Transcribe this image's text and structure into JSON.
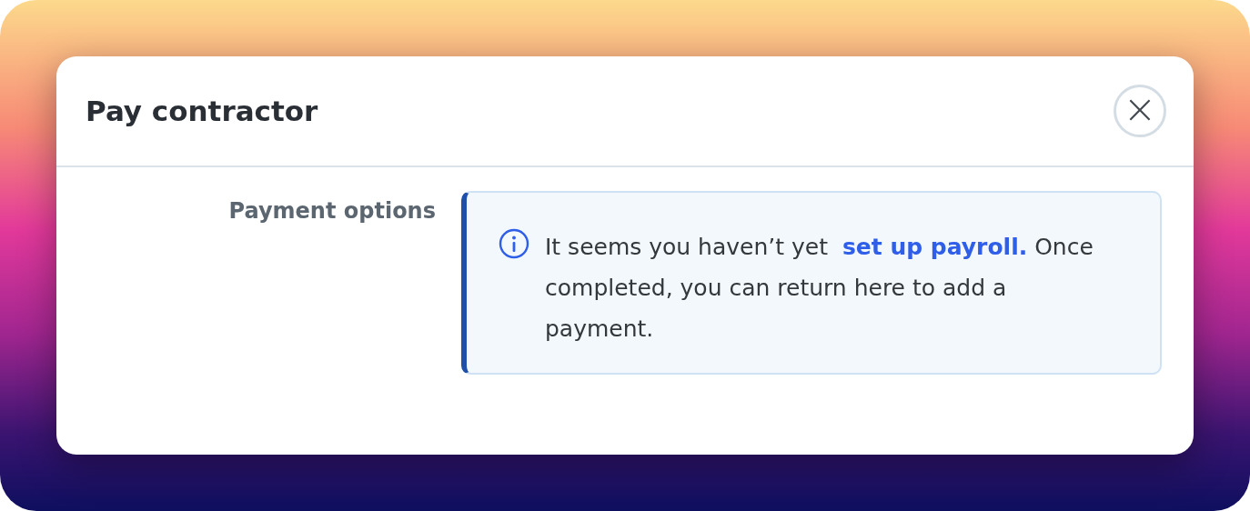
{
  "dialog": {
    "title": "Pay contractor",
    "close_label": "×"
  },
  "field": {
    "label": "Payment options"
  },
  "alert": {
    "text_before": "It seems you haven’t yet",
    "link": "set up payroll.",
    "text_after": "Once completed, you can return here to add a payment."
  }
}
